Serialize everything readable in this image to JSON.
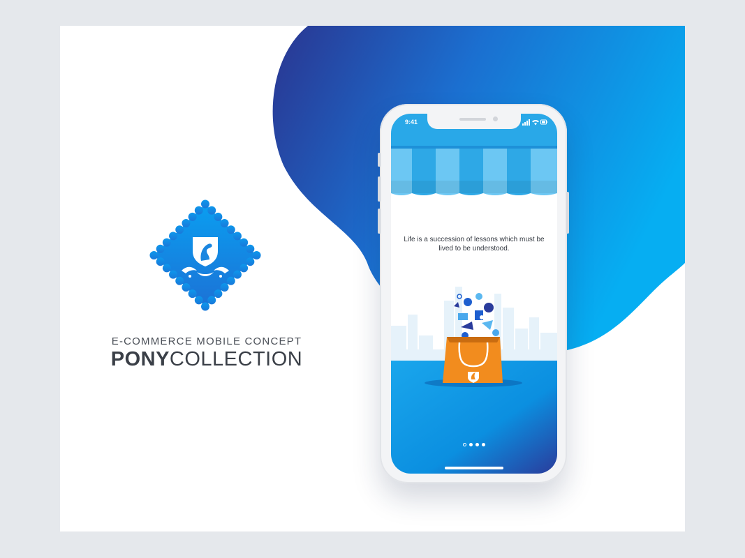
{
  "brand": {
    "subtitle": "E-COMMERCE MOBILE CONCEPT",
    "name_bold": "PONY",
    "name_light": "COLLECTION"
  },
  "phone": {
    "status_time": "9:41",
    "quote": "Life is a succession of lessons which must be lived to be understood.",
    "pager": {
      "total": 4,
      "current": 0
    }
  },
  "colors": {
    "accent": "#0aa8ee",
    "deep_blue": "#2a3590",
    "bag_orange": "#f28c1e",
    "background": "#e5e8ec"
  },
  "icons": [
    "pony-shield-logo",
    "awning",
    "shopping-bag",
    "city-skyline",
    "signal",
    "wifi",
    "battery"
  ]
}
